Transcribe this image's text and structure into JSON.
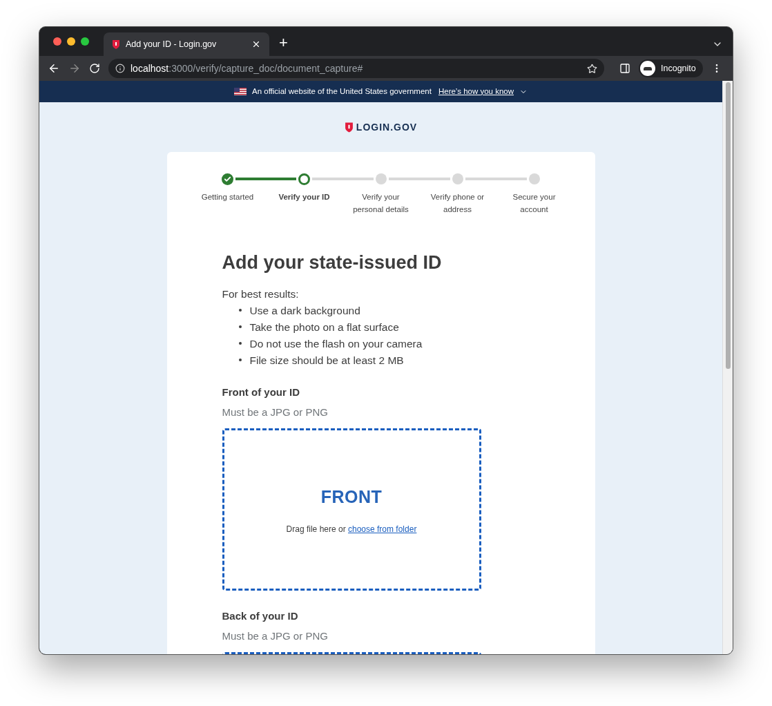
{
  "browser": {
    "tab_title": "Add your ID - Login.gov",
    "new_tab": "+",
    "url_host": "localhost",
    "url_path": ":3000/verify/capture_doc/document_capture#",
    "profile": "Incognito"
  },
  "gov_banner": {
    "text": "An official website of the United States government",
    "link": "Here’s how you know"
  },
  "logo": "LOGIN.GOV",
  "steps": [
    {
      "label": "Getting started",
      "kind": "complete"
    },
    {
      "label": "Verify your ID",
      "kind": "current"
    },
    {
      "label": "Verify your personal details",
      "kind": "pending"
    },
    {
      "label": "Verify phone or address",
      "kind": "pending"
    },
    {
      "label": "Secure your account",
      "kind": "pending"
    }
  ],
  "heading": "Add your state-issued ID",
  "tips_intro": "For best results:",
  "tips": [
    "Use a dark background",
    "Take the photo on a flat surface",
    "Do not use the flash on your camera",
    "File size should be at least 2 MB"
  ],
  "uploads": [
    {
      "label": "Front of your ID",
      "hint": "Must be a JPG or PNG",
      "side": "FRONT",
      "drop_text": "Drag file here or",
      "link": "choose from folder"
    },
    {
      "label": "Back of your ID",
      "hint": "Must be a JPG or PNG"
    }
  ]
}
